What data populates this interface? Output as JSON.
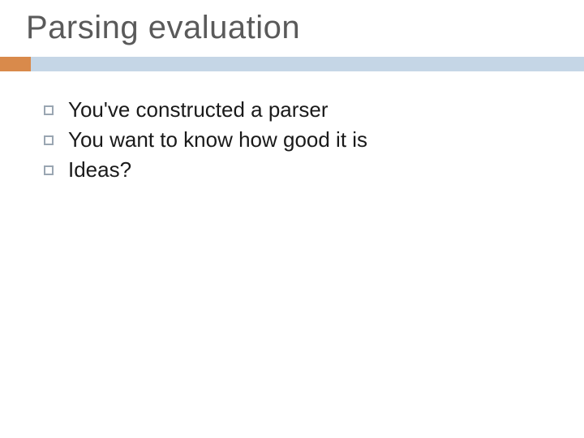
{
  "title": "Parsing evaluation",
  "bullets": [
    "You've constructed a parser",
    "You want to know how good it is",
    "Ideas?"
  ],
  "colors": {
    "accent": "#d98a4b",
    "bar": "#c5d6e6",
    "title": "#5a5a5a",
    "text": "#1a1a1a",
    "bullet_border": "#9aa6b2"
  }
}
